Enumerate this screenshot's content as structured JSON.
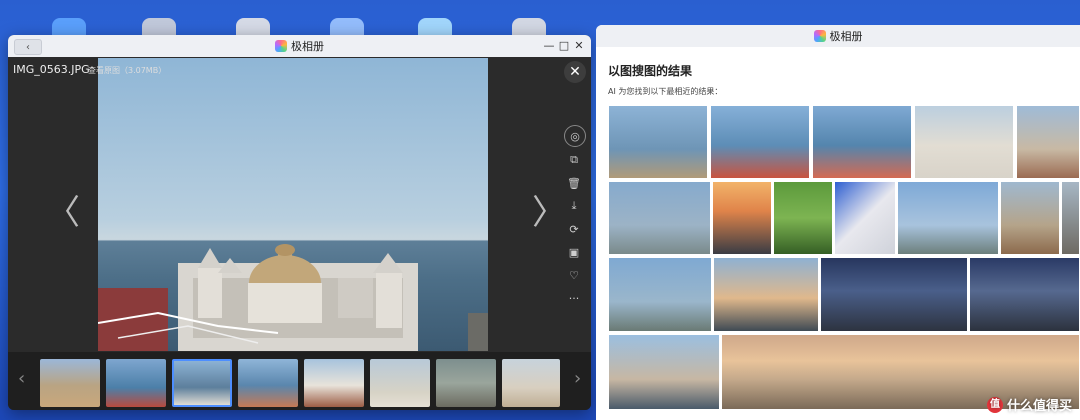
{
  "left_window": {
    "title": "极相册",
    "back_label": "‹",
    "filename": "IMG_0563.JPG",
    "view_original": "查看原图（3.07MB）",
    "close_label": "✕",
    "prev_label": "〈",
    "next_label": "〉",
    "window_controls": [
      "—",
      "□",
      "✕"
    ],
    "tools": [
      "search-image-icon",
      "share-icon",
      "trash-icon",
      "download-icon",
      "rotate-icon",
      "info-icon",
      "heart-icon",
      "more-icon"
    ],
    "tool_glyphs": [
      "◎",
      "⧉",
      "🗑",
      "⤓",
      "⟳",
      "▣",
      "♡",
      "···"
    ],
    "film_prev": "‹",
    "film_next": "›",
    "thumbnails": 8
  },
  "right_window": {
    "title": "极相册",
    "heading": "以图搜图的结果",
    "subtitle": "AI 为您找到以下最相近的结果："
  },
  "watermark": {
    "badge": "值",
    "text": "什么值得买"
  }
}
